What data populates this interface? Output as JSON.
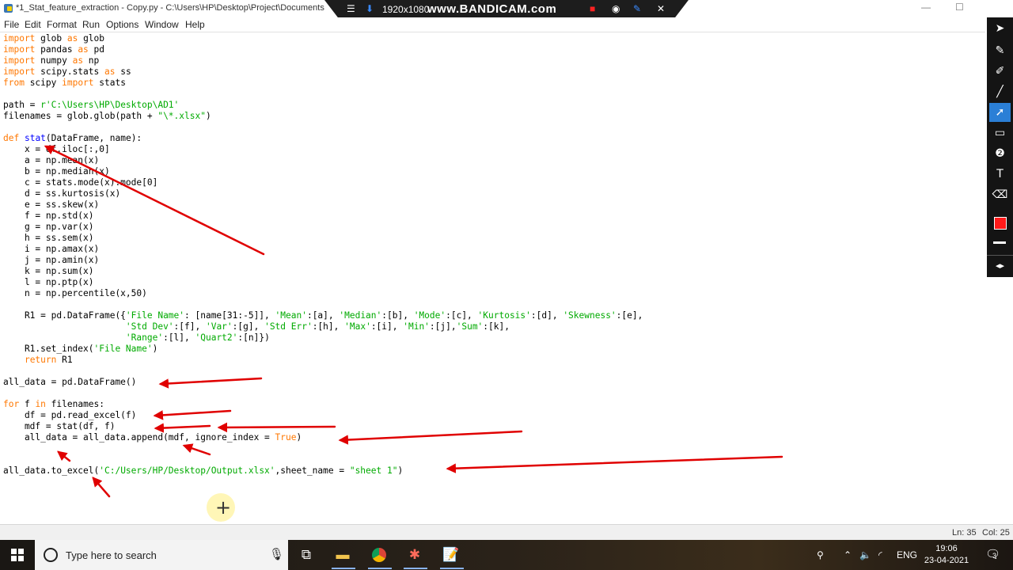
{
  "window": {
    "title": "*1_Stat_feature_extraction - Copy.py - C:\\Users\\HP\\Desktop\\Project\\Documents",
    "minimize": "—",
    "maximize": "☐",
    "close": "✕"
  },
  "recorder": {
    "resolution": "1920x1080",
    "brand": "www.BANDICAM.com"
  },
  "menu": [
    "File",
    "Edit",
    "Format",
    "Run",
    "Options",
    "Window",
    "Help"
  ],
  "code_lines": [
    "<span class=\"kw\">import</span> glob <span class=\"kw\">as</span> glob",
    "<span class=\"kw\">import</span> pandas <span class=\"kw\">as</span> pd",
    "<span class=\"kw\">import</span> numpy <span class=\"kw\">as</span> np",
    "<span class=\"kw\">import</span> scipy.stats <span class=\"kw\">as</span> ss",
    "<span class=\"kw\">from</span> scipy <span class=\"kw\">import</span> stats",
    "",
    "path = <span class=\"str\">r'C:\\Users\\HP\\Desktop\\AD1'</span>",
    "filenames = glob.glob(path + <span class=\"str\">\"\\*.xlsx\"</span>)",
    "",
    "<span class=\"kw\">def</span> <span class=\"fn\">stat</span>(DataFrame, name):",
    "    x = df.iloc[:,0]",
    "    a = np.mean(x)",
    "    b = np.median(x)",
    "    c = stats.mode(x).mode[0]",
    "    d = ss.kurtosis(x)",
    "    e = ss.skew(x)",
    "    f = np.std(x)",
    "    g = np.var(x)",
    "    h = ss.sem(x)",
    "    i = np.amax(x)",
    "    j = np.amin(x)",
    "    k = np.sum(x)",
    "    l = np.ptp(x)",
    "    n = np.percentile(x,50)",
    "",
    "    R1 = pd.DataFrame({<span class=\"str\">'File Name'</span>: [name[31:-5]], <span class=\"str\">'Mean'</span>:[a], <span class=\"str\">'Median'</span>:[b], <span class=\"str\">'Mode'</span>:[c], <span class=\"str\">'Kurtosis'</span>:[d], <span class=\"str\">'Skewness'</span>:[e],",
    "                       <span class=\"str\">'Std Dev'</span>:[f], <span class=\"str\">'Var'</span>:[g], <span class=\"str\">'Std Err'</span>:[h], <span class=\"str\">'Max'</span>:[i], <span class=\"str\">'Min'</span>:[j],<span class=\"str\">'Sum'</span>:[k],",
    "                       <span class=\"str\">'Range'</span>:[l], <span class=\"str\">'Quart2'</span>:[n]})",
    "    R1.set_index(<span class=\"str\">'File Name'</span>)",
    "    <span class=\"kw\">return</span> R1",
    "",
    "all_data = pd.DataFrame()",
    "",
    "<span class=\"kw\">for</span> f <span class=\"kw\">in</span> filenames:",
    "    df = pd.read_excel(f)",
    "    mdf = stat(df, f)",
    "    all_data = all_data.append(mdf, ignore_index = <span class=\"kw\">True</span>)",
    "",
    "",
    "all_data.to_excel(<span class=\"str\">'C:/Users/HP/Desktop/Output.xlsx'</span>,sheet_name = <span class=\"str\">\"sheet 1\"</span>)"
  ],
  "status": {
    "line": "Ln: 35",
    "col": "Col: 25"
  },
  "annotation": {
    "arrow_color": "#e00000"
  },
  "toolbar_tools": [
    "cursor-icon",
    "pencil-icon",
    "marker-icon",
    "line-icon",
    "highlighter-icon",
    "rectangle-icon",
    "numbering-icon",
    "text-icon",
    "eraser-icon"
  ],
  "toolbar_color": "#ff1a1a",
  "taskbar": {
    "search_placeholder": "Type here to search",
    "language": "ENG",
    "time": "19:06",
    "date": "23-04-2021",
    "notification_count": "3"
  }
}
